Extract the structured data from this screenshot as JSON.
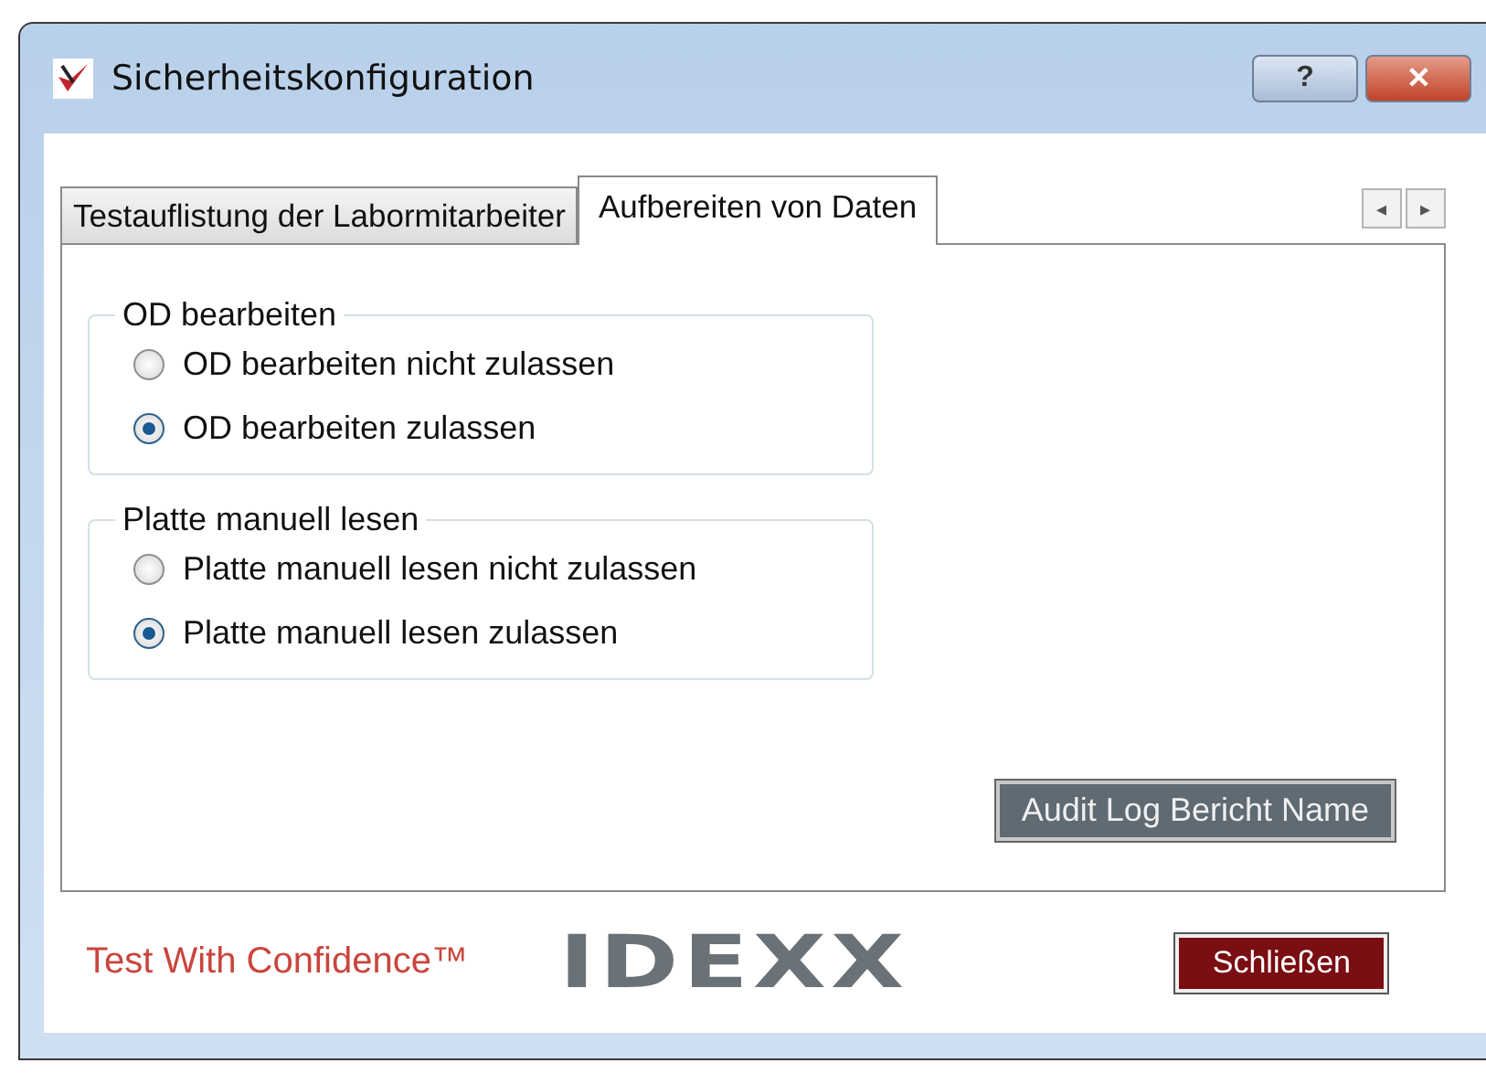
{
  "window": {
    "title": "Sicherheitskonfiguration",
    "buttons": [
      "?",
      "✕"
    ]
  },
  "tabs": [
    {
      "label": "Testauflistung der Labormitarbeiter",
      "selected": false
    },
    {
      "label": "Aufbereiten von Daten",
      "selected": true
    }
  ],
  "tab_scroll": [
    "◂",
    "▸"
  ],
  "groups": [
    {
      "title": "OD bearbeiten",
      "options": [
        {
          "label": "OD bearbeiten nicht zulassen",
          "selected": false
        },
        {
          "label": "OD bearbeiten zulassen",
          "selected": true
        }
      ]
    },
    {
      "title": "Platte manuell lesen",
      "options": [
        {
          "label": "Platte manuell lesen nicht zulassen",
          "selected": false
        },
        {
          "label": "Platte manuell lesen zulassen",
          "selected": true
        }
      ]
    }
  ],
  "audit_button": "Audit Log Bericht Name",
  "footer": {
    "slogan": "Test With Confidence™",
    "logo": "IDEXX",
    "close_button": "Schließen"
  }
}
